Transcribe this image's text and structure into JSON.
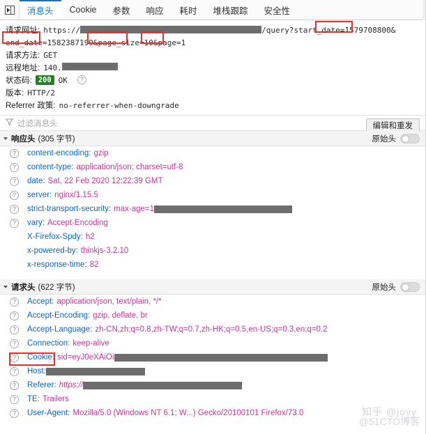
{
  "tabbar": {
    "panel_toggle_icon": "panel-toggle-icon",
    "tabs": [
      {
        "label": "消息头",
        "active": true
      },
      {
        "label": "Cookie",
        "active": false
      },
      {
        "label": "参数",
        "active": false
      },
      {
        "label": "响应",
        "active": false
      },
      {
        "label": "耗时",
        "active": false
      },
      {
        "label": "堆栈跟踪",
        "active": false
      },
      {
        "label": "安全性",
        "active": false
      }
    ]
  },
  "summary": {
    "url_label": "请求网址:",
    "url_scheme": "https://",
    "url_redacted_host": "",
    "url_path": "/query?",
    "url_params_1": "start_date=1579708800&",
    "url_params_2": "end_date=1582387199&page_size=10&page=1",
    "method_label": "请求方法:",
    "method_value": "GET",
    "remote_label": "远程地址:",
    "remote_value": "140.",
    "status_label": "状态码:",
    "status_code": "200",
    "status_text": "OK",
    "status_help_icon": "help-icon",
    "version_label": "版本:",
    "version_value": "HTTP/2",
    "referrer_policy_label": "Referrer 政策:",
    "referrer_policy_value": "no-referrer-when-downgrade",
    "resend_button": "编辑和重发"
  },
  "filter": {
    "icon": "funnel-icon",
    "placeholder": "过滤消息头"
  },
  "response_section": {
    "title": "响应头",
    "bytes": "(305 字节)",
    "raw_label": "原始头",
    "raw_toggle_on": false,
    "rows": [
      {
        "name": "content-encoding",
        "value": "gzip",
        "help": true,
        "redacted": 0
      },
      {
        "name": "content-type",
        "value": "application/json; charset=utf-8",
        "help": true,
        "redacted": 0
      },
      {
        "name": "date",
        "value": "Sat, 22 Feb 2020 12:22:39 GMT",
        "help": true,
        "redacted": 0
      },
      {
        "name": "server",
        "value": "nginx/1.15.5",
        "help": true,
        "redacted": 0
      },
      {
        "name": "strict-transport-security",
        "value": "max-age=1",
        "help": true,
        "redacted": 198
      },
      {
        "name": "vary",
        "value": "Accept-Encoding",
        "help": true,
        "redacted": 0
      },
      {
        "name": "X-Firefox-Spdy",
        "value": "h2",
        "help": false,
        "redacted": 0
      },
      {
        "name": "x-powered-by",
        "value": "thinkjs-3.2.10",
        "help": false,
        "redacted": 0
      },
      {
        "name": "x-response-time",
        "value": "82",
        "help": false,
        "redacted": 0
      }
    ]
  },
  "request_section": {
    "title": "请求头",
    "bytes": "(622 字节)",
    "raw_label": "原始头",
    "raw_toggle_on": false,
    "rows": [
      {
        "name": "Accept",
        "value": "application/json, text/plain, */*",
        "help": true,
        "redacted": 0,
        "italic": false
      },
      {
        "name": "Accept-Encoding",
        "value": "gzip, deflate, br",
        "help": true,
        "redacted": 0,
        "italic": false
      },
      {
        "name": "Accept-Language",
        "value": "zh-CN,zh;q=0.8,zh-TW;q=0.7,zh-HK;q=0.5,en-US;q=0.3,en;q=0.2",
        "help": true,
        "redacted": 0,
        "italic": false
      },
      {
        "name": "Connection",
        "value": "keep-alive",
        "help": true,
        "redacted": 0,
        "italic": false
      },
      {
        "name": "Cookie",
        "value": "sid=eyJ0eXAiOi",
        "help": true,
        "redacted": 306,
        "italic": false
      },
      {
        "name": "Host",
        "value": "",
        "help": true,
        "redacted": 142,
        "italic": false
      },
      {
        "name": "Referer",
        "value": "https://",
        "help": true,
        "redacted": 228,
        "italic": true
      },
      {
        "name": "TE",
        "value": "Trailers",
        "help": true,
        "redacted": 0,
        "italic": false
      },
      {
        "name": "User-Agent",
        "value": "Mozilla/5.0 (Windows NT 6.1; W...) Gecko/20100101 Firefox/73.0",
        "help": true,
        "redacted": 0,
        "italic": false
      }
    ]
  },
  "annotations": {
    "accent_color": "#ef2b2b",
    "boxes": [
      {
        "name": "start-date-param-highlight"
      },
      {
        "name": "end-date-param-highlight"
      },
      {
        "name": "page-size-param-highlight"
      },
      {
        "name": "page-param-highlight"
      },
      {
        "name": "cookie-header-highlight"
      }
    ]
  },
  "watermarks": {
    "top": "知乎 @jovy",
    "bottom": "@51CTO博客"
  },
  "colors": {
    "active_tab": "#0a76c4",
    "header_name": "#0c63c5",
    "header_value": "#cc3399",
    "status_ok": "#238023",
    "redaction": "#6d6d6d"
  }
}
